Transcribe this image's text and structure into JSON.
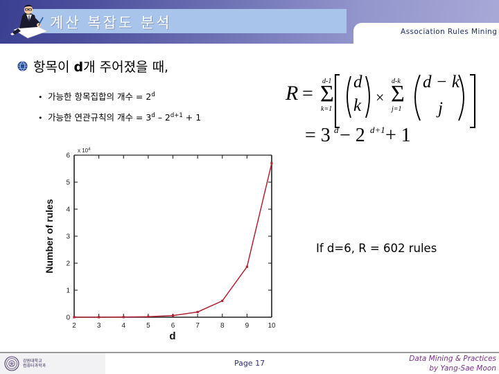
{
  "header": {
    "title": "계산 복잡도 분석",
    "subtitle": "Association Rules Mining",
    "person_icon": "person-writing-icon",
    "band_color": "#a8c4ea",
    "gradient_from": "#3b3f90",
    "gradient_to": "#a7a9d6"
  },
  "body": {
    "bullet_icon": "globe-network-icon",
    "lead_prefix": "항목이 ",
    "lead_bold": "d",
    "lead_suffix": "개 주어졌을 때,",
    "sub_bullets": [
      {
        "dot": "•",
        "text": "가능한 항목집합의 개수 = 2",
        "sup": "d",
        "tail": ""
      },
      {
        "dot": "•",
        "text": "가능한 연관규칙의 개수 = 3",
        "sup": "d",
        "tail": " – 2",
        "sup2": "d+1",
        "tail2": " + 1"
      }
    ]
  },
  "formula": {
    "line1_lhs": "R",
    "line1_eq": "=",
    "sum1_top": "d−1",
    "sum1_bot": "k=1",
    "binom1_top": "d",
    "binom1_bot": "k",
    "times": "×",
    "sum2_top": "d−k",
    "sum2_bot": "j=1",
    "binom2_top": "d − k",
    "binom2_bot": "j",
    "line2": "= 3",
    "line2_sup1": "d",
    "line2_mid": " − 2",
    "line2_sup2": "d+1",
    "line2_tail": " + 1"
  },
  "annotation": {
    "text": "If d=6,  R = 602 rules"
  },
  "chart_data": {
    "type": "line",
    "title": "",
    "xlabel": "d",
    "ylabel": "Number of rules",
    "y_multiplier": "x 10",
    "y_multiplier_exp": "4",
    "x": [
      2,
      3,
      4,
      5,
      6,
      7,
      8,
      9,
      10
    ],
    "values": [
      0,
      6,
      50,
      180,
      602,
      1932,
      6050,
      18660,
      57002
    ],
    "series": [
      {
        "name": "R = 3^d - 2^(d+1) + 1",
        "values": [
          0,
          6,
          50,
          180,
          602,
          1932,
          6050,
          18660,
          57002
        ]
      }
    ],
    "xticks": [
      "2",
      "3",
      "4",
      "5",
      "6",
      "7",
      "8",
      "9",
      "10"
    ],
    "yticks": [
      "0",
      "1",
      "2",
      "3",
      "4",
      "5",
      "6"
    ],
    "ytick_values": [
      0,
      10000,
      20000,
      30000,
      40000,
      50000,
      60000
    ],
    "xlim": [
      2,
      10
    ],
    "ylim": [
      0,
      60000
    ],
    "grid": false,
    "legend": "none",
    "line_color": "#b22233",
    "marker": "dot"
  },
  "footer": {
    "page": "Page 17",
    "credit_line1": "Data Mining & Practices",
    "credit_line2": "by Yang-Sae Moon",
    "logo_icon": "university-seal-icon",
    "logo_line1": "강원대학교",
    "logo_line2": "컴퓨터과학과",
    "credit_color": "#7b2f8f",
    "page_color": "#2f2f7a"
  }
}
